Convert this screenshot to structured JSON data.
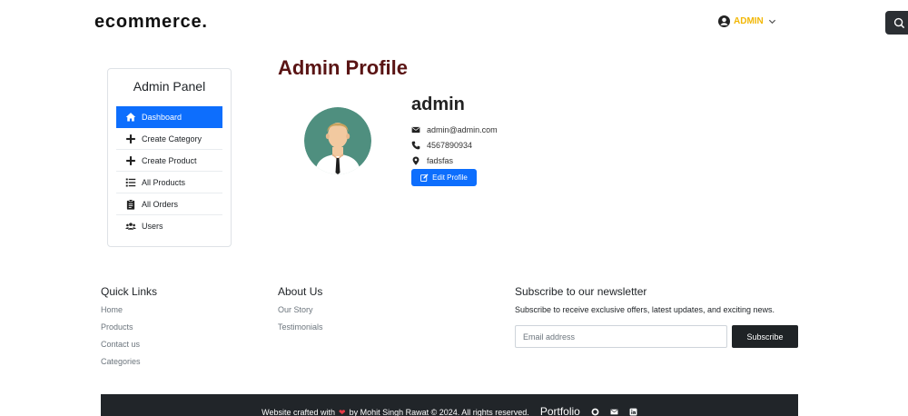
{
  "header": {
    "brand": "ecommerce.",
    "user_label": "ADMIN"
  },
  "colors": {
    "primary": "#0d6efd",
    "brand_dark": "#5a1414",
    "accent_yellow": "#f2b705",
    "footer_dark": "#212529"
  },
  "sidebar": {
    "title": "Admin Panel",
    "items": [
      {
        "label": "Dashboard",
        "icon": "home-icon",
        "active": true
      },
      {
        "label": "Create Category",
        "icon": "plus-icon"
      },
      {
        "label": "Create Product",
        "icon": "plus-icon"
      },
      {
        "label": "All Products",
        "icon": "list-icon"
      },
      {
        "label": "All Orders",
        "icon": "clipboard-icon"
      },
      {
        "label": "Users",
        "icon": "users-icon"
      }
    ]
  },
  "profile": {
    "heading": "Admin Profile",
    "name": "admin",
    "email": "admin@admin.com",
    "phone": "4567890934",
    "address": "fadsfas",
    "edit_label": "Edit Profile"
  },
  "footer": {
    "quick_links": {
      "title": "Quick Links",
      "links": [
        "Home",
        "Products",
        "Contact us",
        "Categories"
      ]
    },
    "about": {
      "title": "About Us",
      "links": [
        "Our Story",
        "Testimonials"
      ]
    },
    "newsletter": {
      "title": "Subscribe to our newsletter",
      "text": "Subscribe to receive exclusive offers, latest updates, and exciting news.",
      "placeholder": "Email address",
      "button": "Subscribe"
    },
    "bottom": {
      "credit_prefix": "Website crafted with",
      "credit_suffix": "by Mohit Singh Rawat © 2024. All rights reserved.",
      "portfolio": "Portfolio"
    }
  }
}
